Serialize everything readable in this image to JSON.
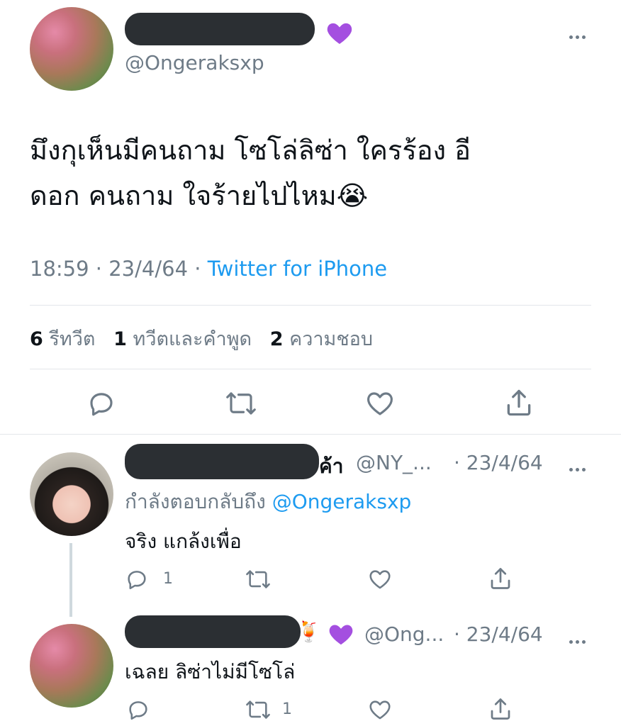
{
  "main_tweet": {
    "handle": "@Ongeraksxp",
    "text_line1": "มึงกุเห็นมีคนถาม โซโล่ลิซ่า ใครร้อง อี",
    "text_line2": "ดอก คนถาม ใจร้ายไปไหม",
    "emoji": "😭",
    "time": "18:59",
    "sep1": "·",
    "date": "23/4/64",
    "sep2": "·",
    "source": "Twitter for iPhone",
    "stats": {
      "retweets_count": "6",
      "retweets_label": "รีทวีต",
      "quotes_count": "1",
      "quotes_label": "ทวีตและคำพูด",
      "likes_count": "2",
      "likes_label": "ความชอบ"
    }
  },
  "reply1": {
    "name_suffix": "ค้า",
    "handle": "@NY_...",
    "date": "· 23/4/64",
    "replying_prefix": "กำลังตอบกลับถึง",
    "replying_handle": "@Ongeraksxp",
    "text": "จริง แกล้งเพื่อ",
    "reply_count": "1"
  },
  "reply2": {
    "emoji": "🍹",
    "handle": "@Ong...",
    "date": "· 23/4/64",
    "text": "เฉลย ลิซ่าไม่มีโซโล่",
    "retweet_count": "1"
  },
  "colors": {
    "accent": "#1d9bf0",
    "purple_heart": "#a44fe0",
    "grey": "#6e7b87"
  },
  "icons": [
    "reply-icon",
    "retweet-icon",
    "like-icon",
    "share-icon",
    "more-icon",
    "purple-heart-icon"
  ]
}
